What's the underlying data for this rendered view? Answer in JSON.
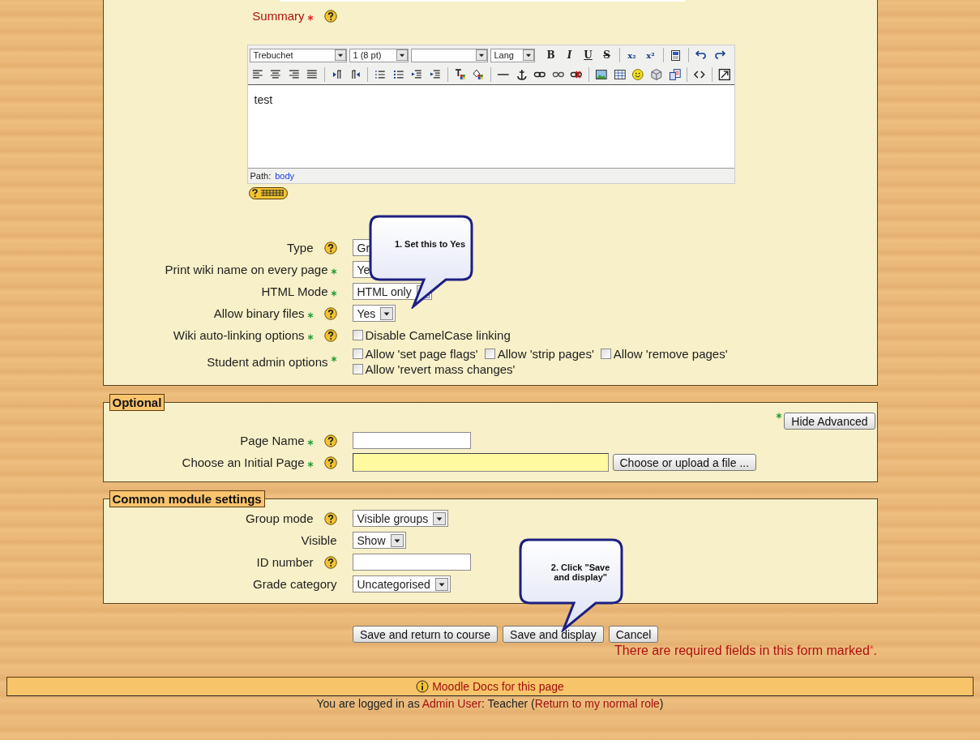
{
  "summary": {
    "label": "Summary",
    "kind": "editor",
    "required": true,
    "help": true,
    "editor": {
      "font": "Trebuchet",
      "size": "1 (8 pt)",
      "lang": "Lang",
      "toolbar_rows": [
        [
          {
            "kind": "bold",
            "glyph": "B"
          },
          {
            "kind": "italic",
            "glyph": "I"
          },
          {
            "kind": "underline",
            "glyph": "U"
          },
          {
            "kind": "strike",
            "glyph": "S"
          },
          {
            "kind": "separator"
          },
          {
            "kind": "subscript",
            "glyph": "x₂"
          },
          {
            "kind": "superscript",
            "glyph": "x²"
          },
          {
            "kind": "separator"
          },
          {
            "kind": "paste-word"
          },
          {
            "kind": "separator"
          },
          {
            "kind": "undo"
          },
          {
            "kind": "redo"
          }
        ],
        [
          {
            "kind": "align-left"
          },
          {
            "kind": "align-center"
          },
          {
            "kind": "align-right"
          },
          {
            "kind": "justify"
          },
          {
            "kind": "separator"
          },
          {
            "kind": "ltr"
          },
          {
            "kind": "rtl"
          },
          {
            "kind": "separator"
          },
          {
            "kind": "ordered-list"
          },
          {
            "kind": "bullet-list"
          },
          {
            "kind": "outdent"
          },
          {
            "kind": "indent"
          },
          {
            "kind": "separator"
          },
          {
            "kind": "text-color"
          },
          {
            "kind": "background-color"
          },
          {
            "kind": "separator"
          },
          {
            "kind": "horizontal-rule"
          },
          {
            "kind": "anchor"
          },
          {
            "kind": "link"
          },
          {
            "kind": "unlink"
          },
          {
            "kind": "no-link"
          },
          {
            "kind": "separator"
          },
          {
            "kind": "image"
          },
          {
            "kind": "table"
          },
          {
            "kind": "smiley"
          },
          {
            "kind": "special-char"
          },
          {
            "kind": "paste-text"
          },
          {
            "kind": "separator"
          },
          {
            "kind": "html-source"
          },
          {
            "kind": "separator"
          },
          {
            "kind": "fullscreen"
          }
        ]
      ],
      "content": "test",
      "path_label": "Path:",
      "path": "body"
    }
  },
  "general_rows": [
    {
      "label": "Type",
      "required": false,
      "help": true,
      "kind": "select",
      "value": "Gr"
    },
    {
      "label": "Print wiki name on every page",
      "required": true,
      "help": false,
      "kind": "select",
      "value": "Ye"
    },
    {
      "label": "HTML Mode",
      "required": true,
      "help": false,
      "kind": "select",
      "value": "HTML only"
    },
    {
      "label": "Allow binary files",
      "required": true,
      "help": true,
      "kind": "select",
      "value": "Yes",
      "callout": "1. Set this to Yes"
    },
    {
      "label": "Wiki auto-linking options",
      "required": true,
      "help": true,
      "kind": "checkboxes",
      "options": [
        {
          "label": "Disable CamelCase linking",
          "checked": false
        }
      ]
    },
    {
      "label": "Student admin options",
      "required": true,
      "help": false,
      "kind": "checkboxes",
      "options": [
        {
          "label": "Allow 'set page flags'",
          "checked": false
        },
        {
          "label": "Allow 'strip pages'",
          "checked": false
        },
        {
          "label": "Allow 'remove pages'",
          "checked": false
        },
        {
          "label": "Allow 'revert mass changes'",
          "checked": false
        }
      ]
    }
  ],
  "sections": [
    {
      "legend": "Optional",
      "advanced_button": "Hide Advanced",
      "rows": [
        {
          "label": "Page Name",
          "required": true,
          "help": true,
          "kind": "text"
        },
        {
          "label": "Choose an Initial Page",
          "required": true,
          "help": true,
          "kind": "file",
          "button": "Choose or upload a file ..."
        }
      ]
    },
    {
      "legend": "Common module settings",
      "rows": [
        {
          "label": "Group mode",
          "required": false,
          "help": true,
          "kind": "select",
          "value": "Visible groups"
        },
        {
          "label": "Visible",
          "required": false,
          "help": false,
          "kind": "select",
          "value": "Show"
        },
        {
          "label": "ID number",
          "required": false,
          "help": true,
          "kind": "text"
        },
        {
          "label": "Grade category",
          "required": false,
          "help": false,
          "kind": "select",
          "value": "Uncategorised"
        }
      ]
    }
  ],
  "buttons": [
    {
      "label": "Save and return to course"
    },
    {
      "label": "Save and display",
      "callout": "2. Click \"Save and display\""
    },
    {
      "label": "Cancel"
    }
  ],
  "required_note": {
    "text": "There are required fields in this form marked",
    "mark": "*",
    "end": "."
  },
  "footer": {
    "docs_link": "Moodle Docs for this page",
    "login": [
      {
        "kind": "text",
        "text": "You are logged in as "
      },
      {
        "kind": "link",
        "text": "Admin User"
      },
      {
        "kind": "text",
        "text": ": Teacher ("
      },
      {
        "kind": "link",
        "text": "Return to my normal role"
      },
      {
        "kind": "text",
        "text": ")"
      }
    ]
  }
}
